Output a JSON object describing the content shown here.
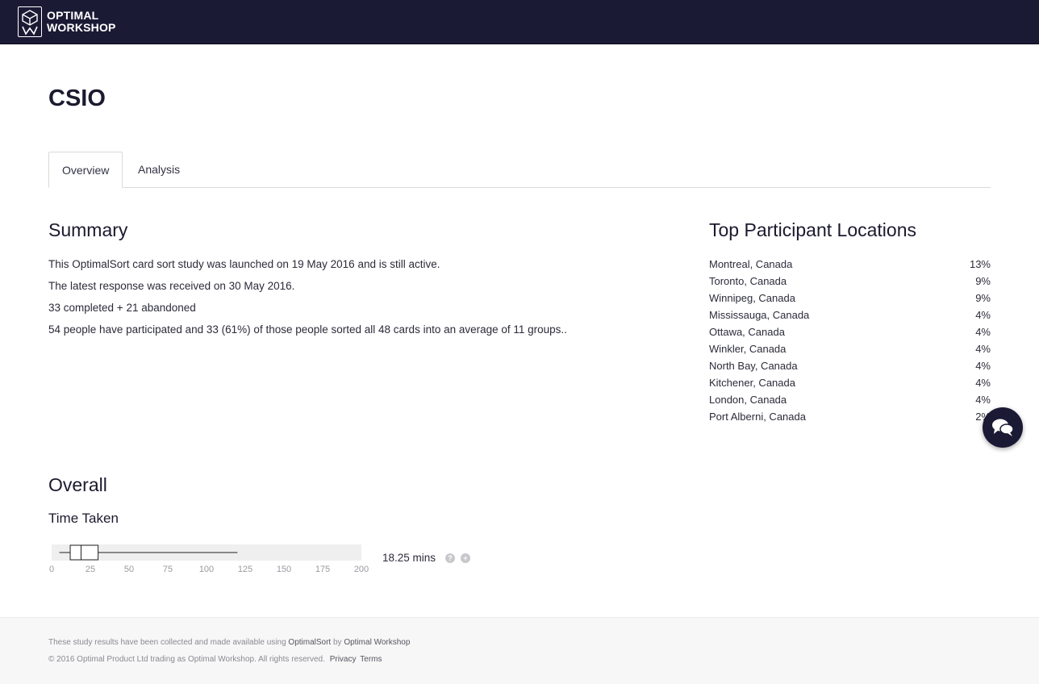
{
  "header": {
    "logo_line1": "OPTIMAL",
    "logo_line2": "WORKSHOP",
    "logo_icon": "optimal-workshop-logo-icon",
    "background": "#1b1a35"
  },
  "page": {
    "title": "CSIO"
  },
  "tabs": [
    {
      "label": "Overview",
      "active": true
    },
    {
      "label": "Analysis",
      "active": false
    }
  ],
  "summary": {
    "title": "Summary",
    "lines": [
      "This OptimalSort card sort study was launched on 19 May 2016 and is still active.",
      "The latest response was received on 30 May 2016.",
      "33 completed + 21 abandoned",
      "54 people have participated and 33 (61%) of those people sorted all 48 cards into an average of 11 groups.."
    ]
  },
  "locations": {
    "title": "Top Participant Locations",
    "rows": [
      {
        "name": "Montreal, Canada",
        "pct": "13%"
      },
      {
        "name": "Toronto, Canada",
        "pct": "9%"
      },
      {
        "name": "Winnipeg, Canada",
        "pct": "9%"
      },
      {
        "name": "Mississauga, Canada",
        "pct": "4%"
      },
      {
        "name": "Ottawa, Canada",
        "pct": "4%"
      },
      {
        "name": "Winkler, Canada",
        "pct": "4%"
      },
      {
        "name": "North Bay, Canada",
        "pct": "4%"
      },
      {
        "name": "Kitchener, Canada",
        "pct": "4%"
      },
      {
        "name": "London, Canada",
        "pct": "4%"
      },
      {
        "name": "Port Alberni, Canada",
        "pct": "2%"
      }
    ]
  },
  "overall": {
    "title": "Overall",
    "time_taken_title": "Time Taken",
    "time_value": "18.25 mins",
    "help_icon": "question-circle-icon",
    "expand_icon": "plus-circle-icon",
    "boxplot": {
      "axis_min": 0,
      "axis_max": 200,
      "ticks": [
        "0",
        "25",
        "50",
        "75",
        "100",
        "125",
        "150",
        "175",
        "200"
      ],
      "whisker_low": 5,
      "q1": 12,
      "median": 19,
      "q3": 30,
      "whisker_high": 120
    }
  },
  "chat": {
    "icon": "chat-bubbles-icon"
  },
  "footer": {
    "line1_prefix": "These study results have been collected and made available using ",
    "line1_link1": "OptimalSort",
    "line1_mid": " by ",
    "line1_link2": "Optimal Workshop",
    "line2_prefix": "© 2016 Optimal Product Ltd trading as Optimal Workshop. All rights reserved.",
    "privacy": "Privacy",
    "terms": "Terms"
  }
}
